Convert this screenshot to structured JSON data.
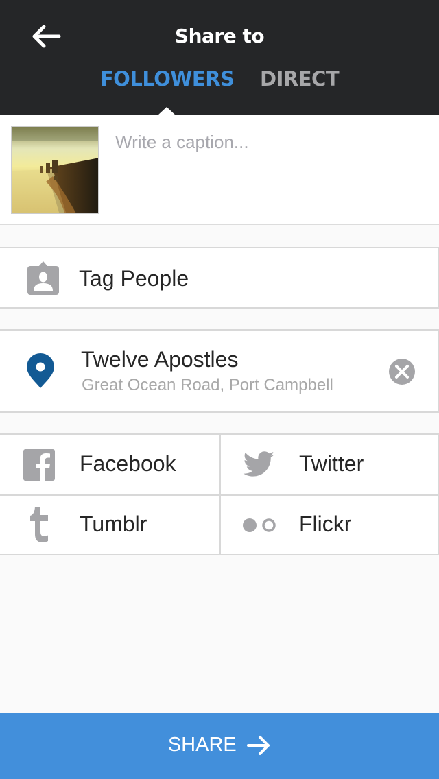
{
  "header": {
    "title": "Share to",
    "back_icon": "arrow-left-icon",
    "tabs": [
      {
        "label": "FOLLOWERS",
        "active": true
      },
      {
        "label": "DIRECT",
        "active": false
      }
    ]
  },
  "caption": {
    "placeholder": "Write a caption...",
    "value": "",
    "thumbnail": "coastal-photo-thumbnail"
  },
  "tag_people": {
    "label": "Tag People",
    "icon": "tag-person-icon"
  },
  "location": {
    "name": "Twelve Apostles",
    "address": "Great Ocean Road, Port Campbell",
    "icon": "location-pin-icon",
    "clear_icon": "clear-circle-icon",
    "pin_color": "#135a94"
  },
  "social": [
    {
      "label": "Facebook",
      "icon": "facebook-icon"
    },
    {
      "label": "Twitter",
      "icon": "twitter-icon"
    },
    {
      "label": "Tumblr",
      "icon": "tumblr-icon"
    },
    {
      "label": "Flickr",
      "icon": "flickr-icon"
    }
  ],
  "share_button": {
    "label": "SHARE",
    "icon": "arrow-right-icon",
    "color": "#428fdb"
  }
}
